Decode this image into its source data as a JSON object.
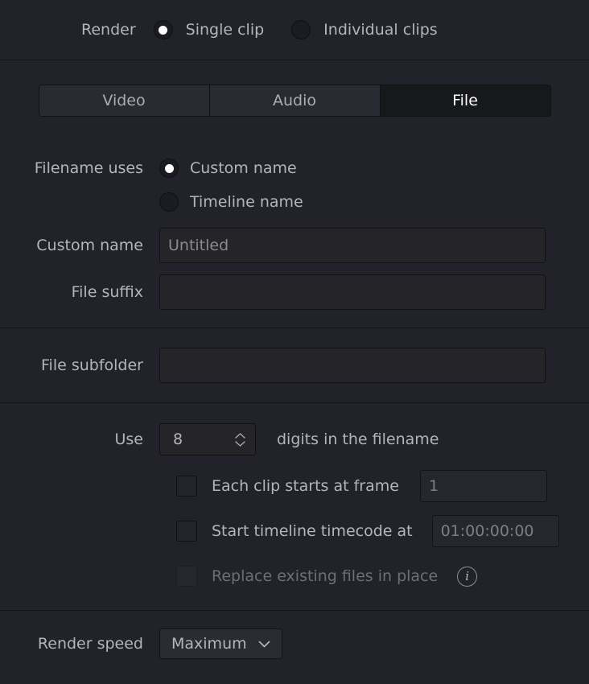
{
  "render": {
    "label": "Render",
    "options": [
      {
        "label": "Single clip",
        "selected": true
      },
      {
        "label": "Individual clips",
        "selected": false
      }
    ]
  },
  "tabs": [
    {
      "label": "Video",
      "active": false
    },
    {
      "label": "Audio",
      "active": false
    },
    {
      "label": "File",
      "active": true
    }
  ],
  "filename": {
    "uses_label": "Filename uses",
    "options": [
      {
        "label": "Custom name",
        "selected": true
      },
      {
        "label": "Timeline name",
        "selected": false
      }
    ],
    "custom_name_label": "Custom name",
    "custom_name_value": "Untitled",
    "file_suffix_label": "File suffix",
    "file_suffix_value": ""
  },
  "subfolder": {
    "label": "File subfolder",
    "value": ""
  },
  "digits": {
    "use_label": "Use",
    "value": "8",
    "suffix_label": "digits in the filename"
  },
  "checkboxes": [
    {
      "label": "Each clip starts at frame",
      "checked": false,
      "disabled": false,
      "field_value": "1"
    },
    {
      "label": "Start timeline timecode at",
      "checked": false,
      "disabled": false,
      "field_value": "01:00:00:00"
    },
    {
      "label": "Replace existing files in place",
      "checked": false,
      "disabled": true,
      "info": "info-icon"
    }
  ],
  "render_speed": {
    "label": "Render speed",
    "value": "Maximum"
  },
  "colors": {
    "background": "#22232a",
    "divider": "#141419",
    "text": "#b4b5b9",
    "text_dim": "#6e6f74",
    "active_tab_bg": "#17181c",
    "field_bg": "#242429"
  }
}
